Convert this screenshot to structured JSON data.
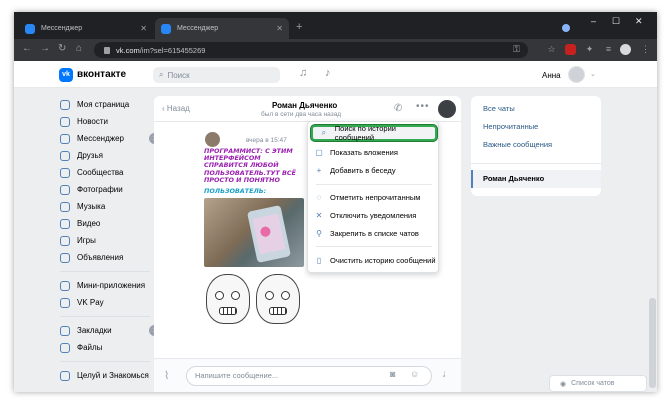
{
  "browser": {
    "tabs": [
      {
        "label": "Мессенджер",
        "close": "✕"
      },
      {
        "label": "Мессенджер",
        "close": "✕"
      }
    ],
    "new_tab": "+",
    "window_controls": [
      "–",
      "☐",
      "✕"
    ],
    "address": {
      "host": "vk.com",
      "path": "/im?sel=615455269"
    }
  },
  "vk_header": {
    "logo_letters": "vk",
    "brand": "вконтакте",
    "search_placeholder": "Поиск",
    "user_name": "Анна"
  },
  "left_menu": {
    "items": [
      {
        "label": "Моя страница",
        "badge": ""
      },
      {
        "label": "Новости",
        "badge": ""
      },
      {
        "label": "Мессенджер",
        "badge": "1"
      },
      {
        "label": "Друзья",
        "badge": ""
      },
      {
        "label": "Сообщества",
        "badge": ""
      },
      {
        "label": "Фотографии",
        "badge": ""
      },
      {
        "label": "Музыка",
        "badge": ""
      },
      {
        "label": "Видео",
        "badge": ""
      },
      {
        "label": "Игры",
        "badge": ""
      },
      {
        "label": "Объявления",
        "badge": ""
      }
    ],
    "items2": [
      {
        "label": "Мини-приложения",
        "badge": ""
      },
      {
        "label": "VK Pay",
        "badge": ""
      }
    ],
    "items3": [
      {
        "label": "Закладки",
        "badge": "1"
      },
      {
        "label": "Файлы",
        "badge": ""
      }
    ],
    "items4": [
      {
        "label": "Целуй и Знакомься",
        "badge": ""
      }
    ]
  },
  "chat": {
    "back_label": "Назад",
    "peer_name": "Роман Дьяченко",
    "peer_status": "был в сети два часа назад",
    "message_time": "вчера в 15:47",
    "meme_text_1": "ПРОГРАММИСТ: С ЭТИМ ИНТЕРФЕЙСОМ СПРАВИТСЯ ЛЮБОЙ ПОЛЬЗОВАТЕЛЬ.ТУТ ВСЁ ПРОСТО И ПОНЯТНО",
    "meme_text_2": "ПОЛЬЗОВАТЕЛЬ:",
    "composer_placeholder": "Напишите сообщение..."
  },
  "dropdown": {
    "items": [
      {
        "icon": "search-icon",
        "glyph": "⌕",
        "label": "Поиск по истории сообщений"
      },
      {
        "icon": "attachment-icon",
        "glyph": "▢",
        "label": "Показать вложения"
      },
      {
        "icon": "add-user-icon",
        "glyph": "+",
        "label": "Добавить в беседу"
      },
      {
        "icon": "unread-icon",
        "glyph": "◌",
        "label": "Отметить непрочитанным"
      },
      {
        "icon": "mute-icon",
        "glyph": "✕",
        "label": "Отключить уведомления"
      },
      {
        "icon": "pin-icon",
        "glyph": "⚲",
        "label": "Закрепить в списке чатов"
      },
      {
        "icon": "trash-icon",
        "glyph": "▯",
        "label": "Очистить историю сообщений"
      }
    ]
  },
  "right_panel": {
    "filters": [
      "Все чаты",
      "Непрочитанные",
      "Важные сообщения"
    ],
    "active_chat": "Роман Дьяченко"
  },
  "chat_list_button": "Список чатов",
  "colors": {
    "vk_blue": "#0077ff",
    "link": "#2a5885",
    "highlight": "#34a853"
  }
}
